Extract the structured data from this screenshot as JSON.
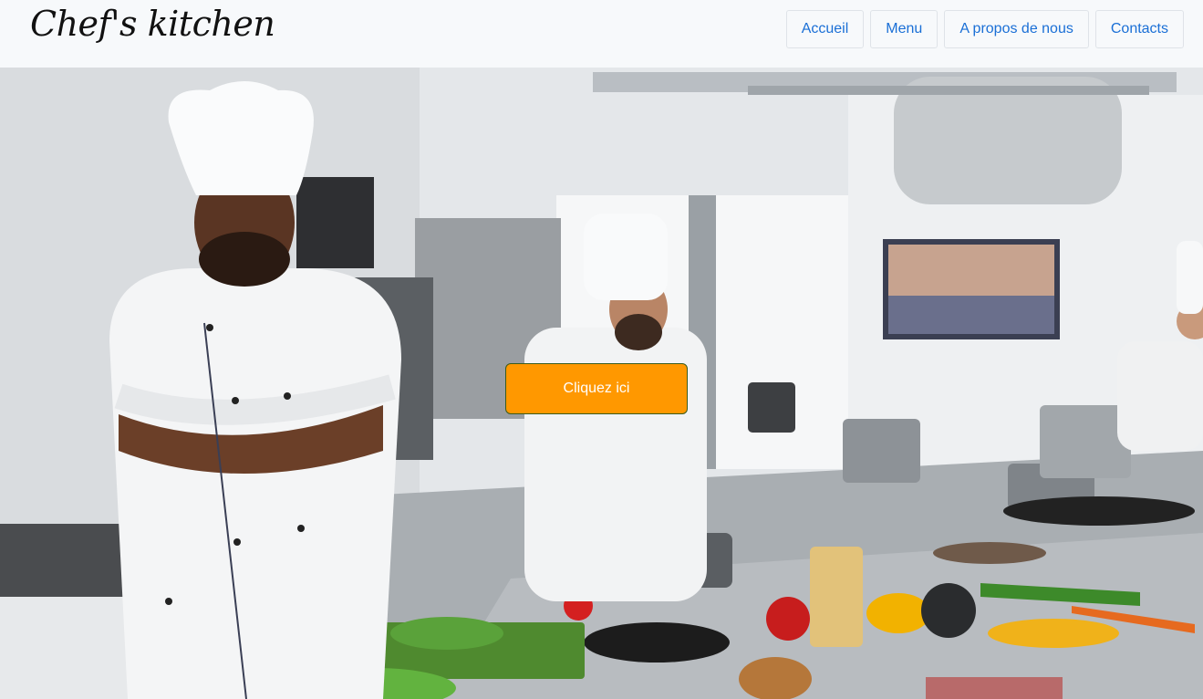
{
  "brand": {
    "name": "Chef's kitchen"
  },
  "nav": {
    "items": [
      {
        "label": "Accueil"
      },
      {
        "label": "Menu"
      },
      {
        "label": "A propos de nous"
      },
      {
        "label": "Contacts"
      }
    ]
  },
  "hero": {
    "cta_label": "Cliquez ici",
    "cta_color": "#ff9800",
    "link_color": "#1a6fd6"
  }
}
